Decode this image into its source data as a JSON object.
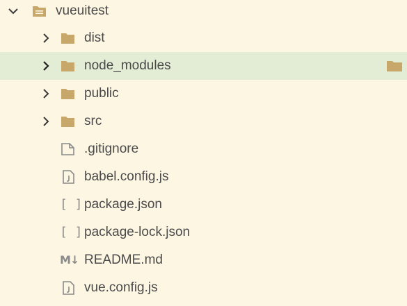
{
  "root": {
    "name": "vueuitest",
    "expanded": true
  },
  "items": [
    {
      "name": "dist",
      "type": "folder",
      "expanded": false
    },
    {
      "name": "node_modules",
      "type": "folder",
      "expanded": false,
      "selected": true
    },
    {
      "name": "public",
      "type": "folder",
      "expanded": false
    },
    {
      "name": "src",
      "type": "folder",
      "expanded": false
    },
    {
      "name": ".gitignore",
      "type": "file",
      "icon": "file-icon"
    },
    {
      "name": "babel.config.js",
      "type": "file",
      "icon": "js-file-icon"
    },
    {
      "name": "package.json",
      "type": "file",
      "icon": "json-file-icon"
    },
    {
      "name": "package-lock.json",
      "type": "file",
      "icon": "json-file-icon"
    },
    {
      "name": "README.md",
      "type": "file",
      "icon": "markdown-file-icon"
    },
    {
      "name": "vue.config.js",
      "type": "file",
      "icon": "js-file-icon"
    }
  ],
  "colors": {
    "background": "#fdf6e3",
    "selection": "#e3ecd5",
    "folder": "#c8a86a",
    "chevron": "#3a3a3a",
    "file_outline": "#8a8a8a"
  },
  "icons": {
    "json_glyph": "[ ]",
    "markdown_glyph": "M↓"
  }
}
